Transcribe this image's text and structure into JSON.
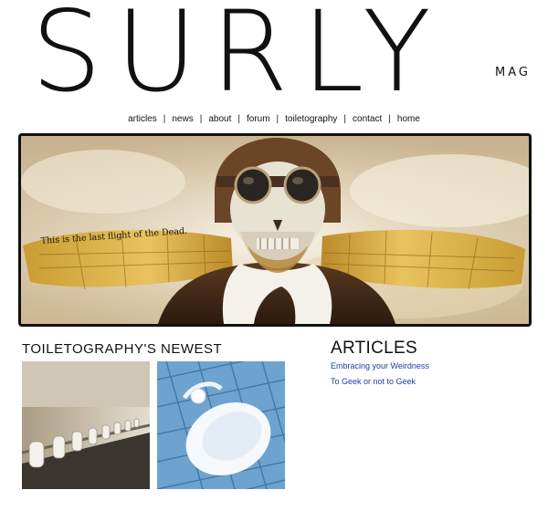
{
  "logo": {
    "word": "SURLY",
    "sub": "MAG"
  },
  "nav": {
    "items": [
      {
        "label": "articles"
      },
      {
        "label": "news"
      },
      {
        "label": "about"
      },
      {
        "label": "forum"
      },
      {
        "label": "toiletography"
      },
      {
        "label": "contact"
      },
      {
        "label": "home"
      }
    ],
    "separator": "|"
  },
  "banner": {
    "caption": "This is the last flight of the Dead."
  },
  "toiletography": {
    "heading": "TOILETOGRAPHY'S NEWEST"
  },
  "articles": {
    "heading": "ARTICLES",
    "links": [
      {
        "label": "Embracing your Weirdness"
      },
      {
        "label": "To Geek or not to Geek"
      }
    ]
  },
  "colors": {
    "link": "#1a3fa6",
    "text": "#111111",
    "banner_border": "#111111"
  }
}
